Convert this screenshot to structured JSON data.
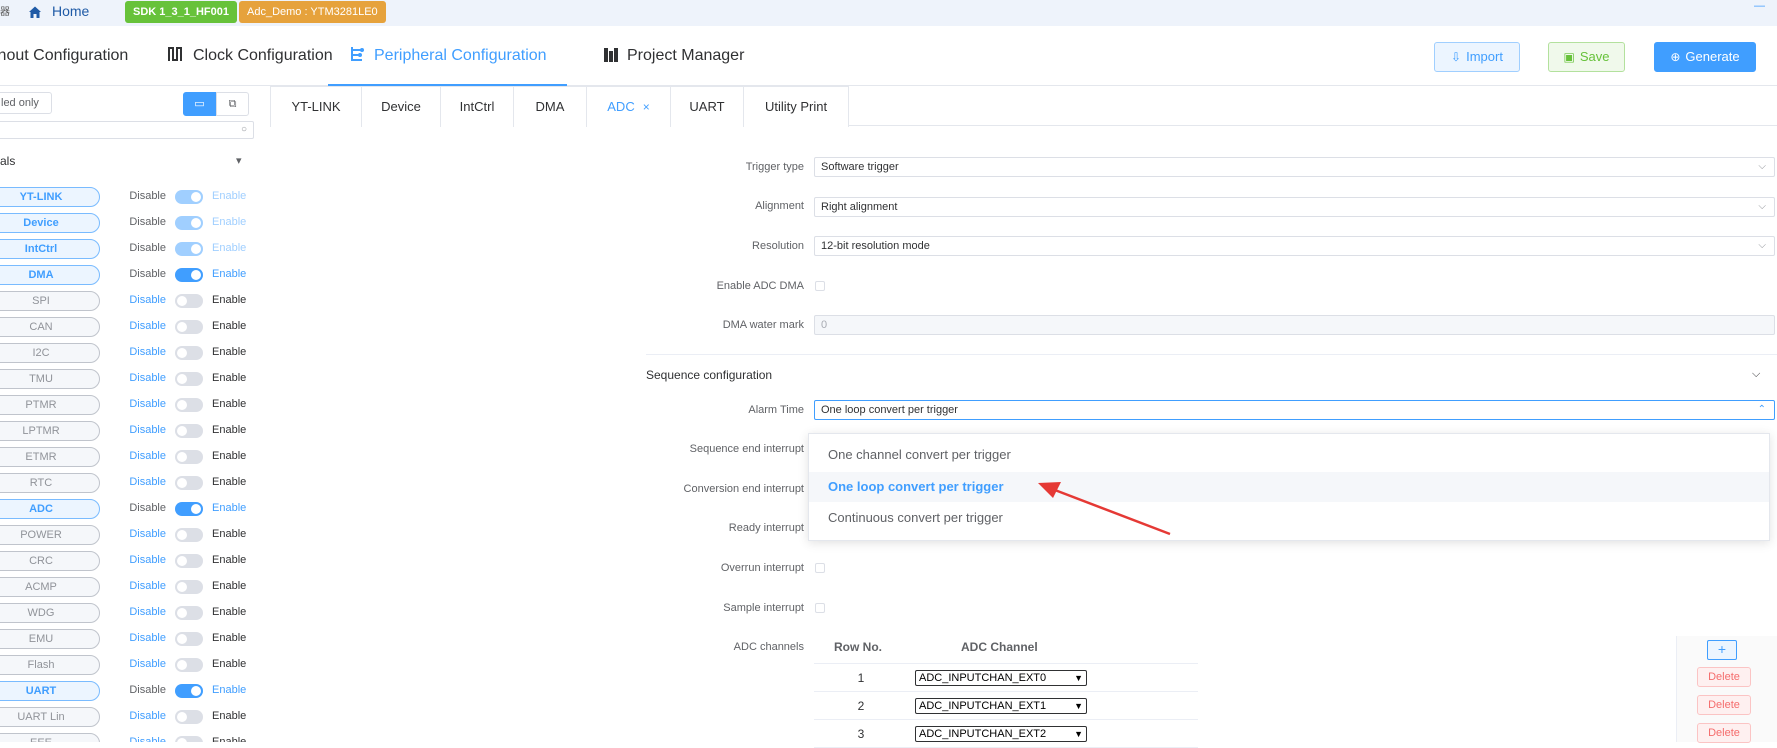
{
  "topbar": {
    "logo_fragment": "器",
    "home_label": "Home",
    "sdk_badge": "SDK 1_3_1_HF001",
    "project_badge": "Adc_Demo : YTM3281LE0",
    "min_glyph": "—"
  },
  "nav": {
    "tabs": [
      {
        "label": "inout Configuration"
      },
      {
        "label": "Clock Configuration"
      },
      {
        "label": "Peripheral Configuration"
      },
      {
        "label": "Project Manager"
      }
    ],
    "active_index": 2,
    "import_label": "Import",
    "save_label": "Save",
    "generate_label": "Generate"
  },
  "sidebar": {
    "enabled_only_label": "led only",
    "group_label": "als",
    "disable_label": "Disable",
    "enable_label": "Enable",
    "peripherals": [
      {
        "name": "YT-LINK",
        "enabled": true,
        "locked": true
      },
      {
        "name": "Device",
        "enabled": true,
        "locked": true
      },
      {
        "name": "IntCtrl",
        "enabled": true,
        "locked": true
      },
      {
        "name": "DMA",
        "enabled": true,
        "locked": false
      },
      {
        "name": "SPI",
        "enabled": false,
        "locked": false
      },
      {
        "name": "CAN",
        "enabled": false,
        "locked": false
      },
      {
        "name": "I2C",
        "enabled": false,
        "locked": false
      },
      {
        "name": "TMU",
        "enabled": false,
        "locked": false
      },
      {
        "name": "PTMR",
        "enabled": false,
        "locked": false
      },
      {
        "name": "LPTMR",
        "enabled": false,
        "locked": false
      },
      {
        "name": "ETMR",
        "enabled": false,
        "locked": false
      },
      {
        "name": "RTC",
        "enabled": false,
        "locked": false
      },
      {
        "name": "ADC",
        "enabled": true,
        "locked": false
      },
      {
        "name": "POWER",
        "enabled": false,
        "locked": false
      },
      {
        "name": "CRC",
        "enabled": false,
        "locked": false
      },
      {
        "name": "ACMP",
        "enabled": false,
        "locked": false
      },
      {
        "name": "WDG",
        "enabled": false,
        "locked": false
      },
      {
        "name": "EMU",
        "enabled": false,
        "locked": false
      },
      {
        "name": "Flash",
        "enabled": false,
        "locked": false
      },
      {
        "name": "UART",
        "enabled": true,
        "locked": false
      },
      {
        "name": "UART Lin",
        "enabled": false,
        "locked": false
      },
      {
        "name": "EEE",
        "enabled": false,
        "locked": false
      }
    ]
  },
  "peripheral_tabs": {
    "tabs": [
      "YT-LINK",
      "Device",
      "IntCtrl",
      "DMA",
      "ADC",
      "UART",
      "Utility Print"
    ],
    "active": "ADC",
    "close_glyph": "×"
  },
  "form": {
    "trigger_type": {
      "label": "Trigger type",
      "value": "Software trigger"
    },
    "alignment": {
      "label": "Alignment",
      "value": "Right alignment"
    },
    "resolution": {
      "label": "Resolution",
      "value": "12-bit resolution mode"
    },
    "enable_adc_dma": {
      "label": "Enable ADC DMA",
      "checked": false
    },
    "dma_water_mark": {
      "label": "DMA water mark",
      "value": "0"
    },
    "section_title": "Sequence configuration",
    "alarm_time": {
      "label": "Alarm Time",
      "value": "One loop convert per trigger"
    },
    "sequence_end_interrupt": {
      "label": "Sequence end interrupt"
    },
    "conversion_end_interrupt": {
      "label": "Conversion end interrupt"
    },
    "ready_interrupt": {
      "label": "Ready interrupt"
    },
    "overrun_interrupt": {
      "label": "Overrun interrupt",
      "checked": false
    },
    "sample_interrupt": {
      "label": "Sample interrupt",
      "checked": false
    },
    "adc_channels_label": "ADC channels"
  },
  "dropdown": {
    "options": [
      "One channel convert per trigger",
      "One loop convert per trigger",
      "Continuous convert per trigger"
    ],
    "selected_index": 1
  },
  "channels_table": {
    "headers": [
      "Row No.",
      "ADC Channel"
    ],
    "rows": [
      {
        "row": "1",
        "channel": "ADC_INPUTCHAN_EXT0"
      },
      {
        "row": "2",
        "channel": "ADC_INPUTCHAN_EXT1"
      },
      {
        "row": "3",
        "channel": "ADC_INPUTCHAN_EXT2"
      }
    ],
    "add_label": "+",
    "delete_label": "Delete"
  },
  "colors": {
    "accent": "#409eff",
    "annotation_arrow": "#e53935",
    "sdk_badge": "#67c23a",
    "project_badge": "#e6a23c"
  }
}
